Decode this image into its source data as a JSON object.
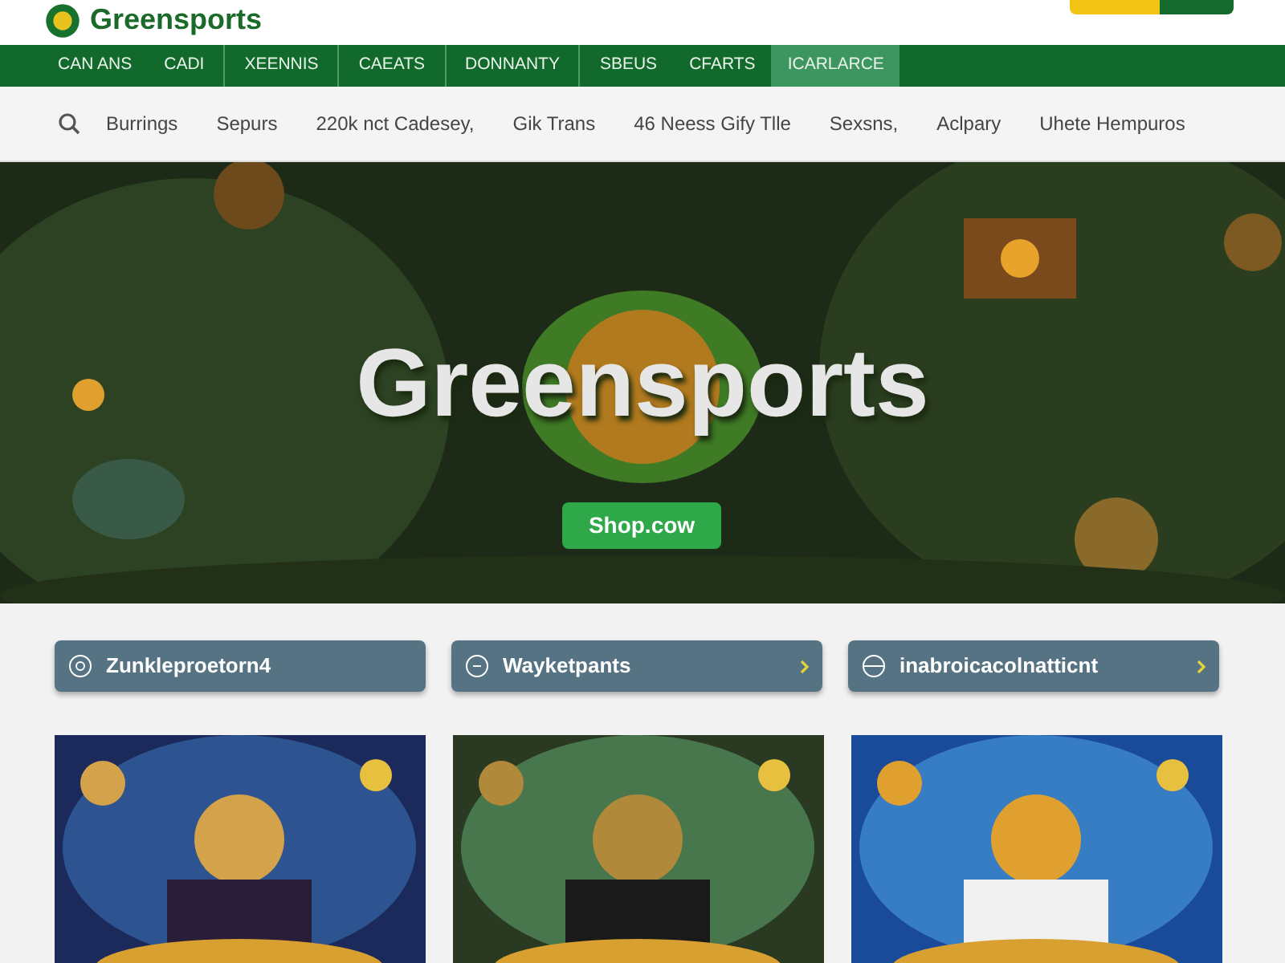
{
  "header": {
    "logo": "Greensports"
  },
  "main_nav": [
    {
      "label": "CAN ANS",
      "selected": false
    },
    {
      "label": "CADI",
      "selected": false
    },
    {
      "label": "XEENNIS",
      "selected": false
    },
    {
      "label": "CAEATS",
      "selected": false
    },
    {
      "label": "DONNANTY",
      "selected": false
    },
    {
      "label": "SBEUS",
      "selected": false
    },
    {
      "label": "CFARTS",
      "selected": false
    },
    {
      "label": "ICARLARCE",
      "selected": true
    }
  ],
  "sub_nav": [
    "Burrings",
    "Sepurs",
    "220k nct Cadesey,",
    "Gik Trans",
    "46 Neess Gify Tlle",
    "Sexsns,",
    "Aclpary",
    "Uhete Hempuros"
  ],
  "hero": {
    "title": "Greensports",
    "button": "Shop.cow"
  },
  "categories": [
    {
      "label": "Zunkleproetorn4",
      "chevron": false
    },
    {
      "label": "Wayketpants",
      "chevron": true
    },
    {
      "label": "inabroicacolnatticnt",
      "chevron": true
    }
  ]
}
